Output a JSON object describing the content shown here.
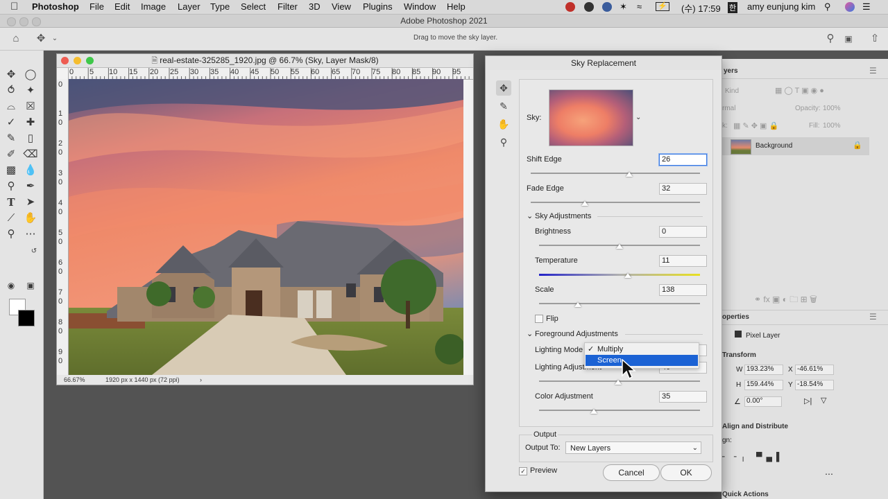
{
  "menubar": {
    "app": "Photoshop",
    "items": [
      "File",
      "Edit",
      "Image",
      "Layer",
      "Type",
      "Select",
      "Filter",
      "3D",
      "View",
      "Plugins",
      "Window",
      "Help"
    ],
    "time": "(수) 17:59",
    "user": "amy eunjung kim"
  },
  "titlebar": {
    "title": "Adobe Photoshop 2021"
  },
  "optionsbar": {
    "hint": "Drag to move the sky layer."
  },
  "document": {
    "title": "real-estate-325285_1920.jpg @ 66.7% (Sky, Layer Mask/8)",
    "zoom": "66.67%",
    "dimensions": "1920 px x 1440 px (72 ppi)",
    "hruler_ticks": [
      "0",
      "5",
      "10",
      "15",
      "20",
      "25",
      "30",
      "35",
      "40",
      "45",
      "50",
      "55",
      "60",
      "65",
      "70",
      "75",
      "80",
      "85",
      "90",
      "95"
    ],
    "vruler_ticks": [
      "0",
      "1 0",
      "2 0",
      "3 0",
      "4 0",
      "5 0",
      "6 0",
      "7 0",
      "8 0",
      "9 0"
    ]
  },
  "dock": {
    "layers_tab": "yers",
    "kind": "Kind",
    "blend": "rmal",
    "opacity_label": "Opacity:",
    "opacity_value": "100%",
    "fill_label": "Fill:",
    "fill_value": "100%",
    "lock_label": "k:",
    "layer_name": "Background",
    "properties_tab": "operties",
    "pixel_layer": "Pixel Layer",
    "transform": "Transform",
    "w_label": "W",
    "w_value": "193.23%",
    "x_label": "X",
    "x_value": "-46.61%",
    "h_label": "H",
    "h_value": "159.44%",
    "y_label": "Y",
    "y_value": "-18.54%",
    "angle": "0.00°",
    "align": "Align and Distribute",
    "align_sub": "gn:",
    "quick_actions": "Quick Actions"
  },
  "dialog": {
    "title": "Sky Replacement",
    "sky_label": "Sky:",
    "shift_edge": {
      "label": "Shift Edge",
      "value": "26",
      "pos": 0.58
    },
    "fade_edge": {
      "label": "Fade Edge",
      "value": "32",
      "pos": 0.32
    },
    "sky_adjustments": "Sky Adjustments",
    "brightness": {
      "label": "Brightness",
      "value": "0",
      "pos": 0.5
    },
    "temperature": {
      "label": "Temperature",
      "value": "11",
      "pos": 0.55
    },
    "scale": {
      "label": "Scale",
      "value": "138",
      "pos": 0.24
    },
    "flip": "Flip",
    "foreground_adjustments": "Foreground Adjustments",
    "lighting_mode": "Lighting Mode",
    "lighting_adjustment": {
      "label": "Lighting Adjustment",
      "value": "40",
      "pos": 0.49
    },
    "color_adjustment": {
      "label": "Color Adjustment",
      "value": "35",
      "pos": 0.34
    },
    "output": "Output",
    "output_to_label": "Output To:",
    "output_to_value": "New Layers",
    "preview": "Preview",
    "cancel": "Cancel",
    "ok": "OK"
  },
  "dropdown": {
    "items": [
      "Multiply",
      "Screen"
    ],
    "checked": "Multiply",
    "highlighted": "Screen"
  },
  "colors": {
    "accent": "#1b62d4",
    "sky_peach": "#f08a6a",
    "sky_blue": "#5a6488"
  }
}
